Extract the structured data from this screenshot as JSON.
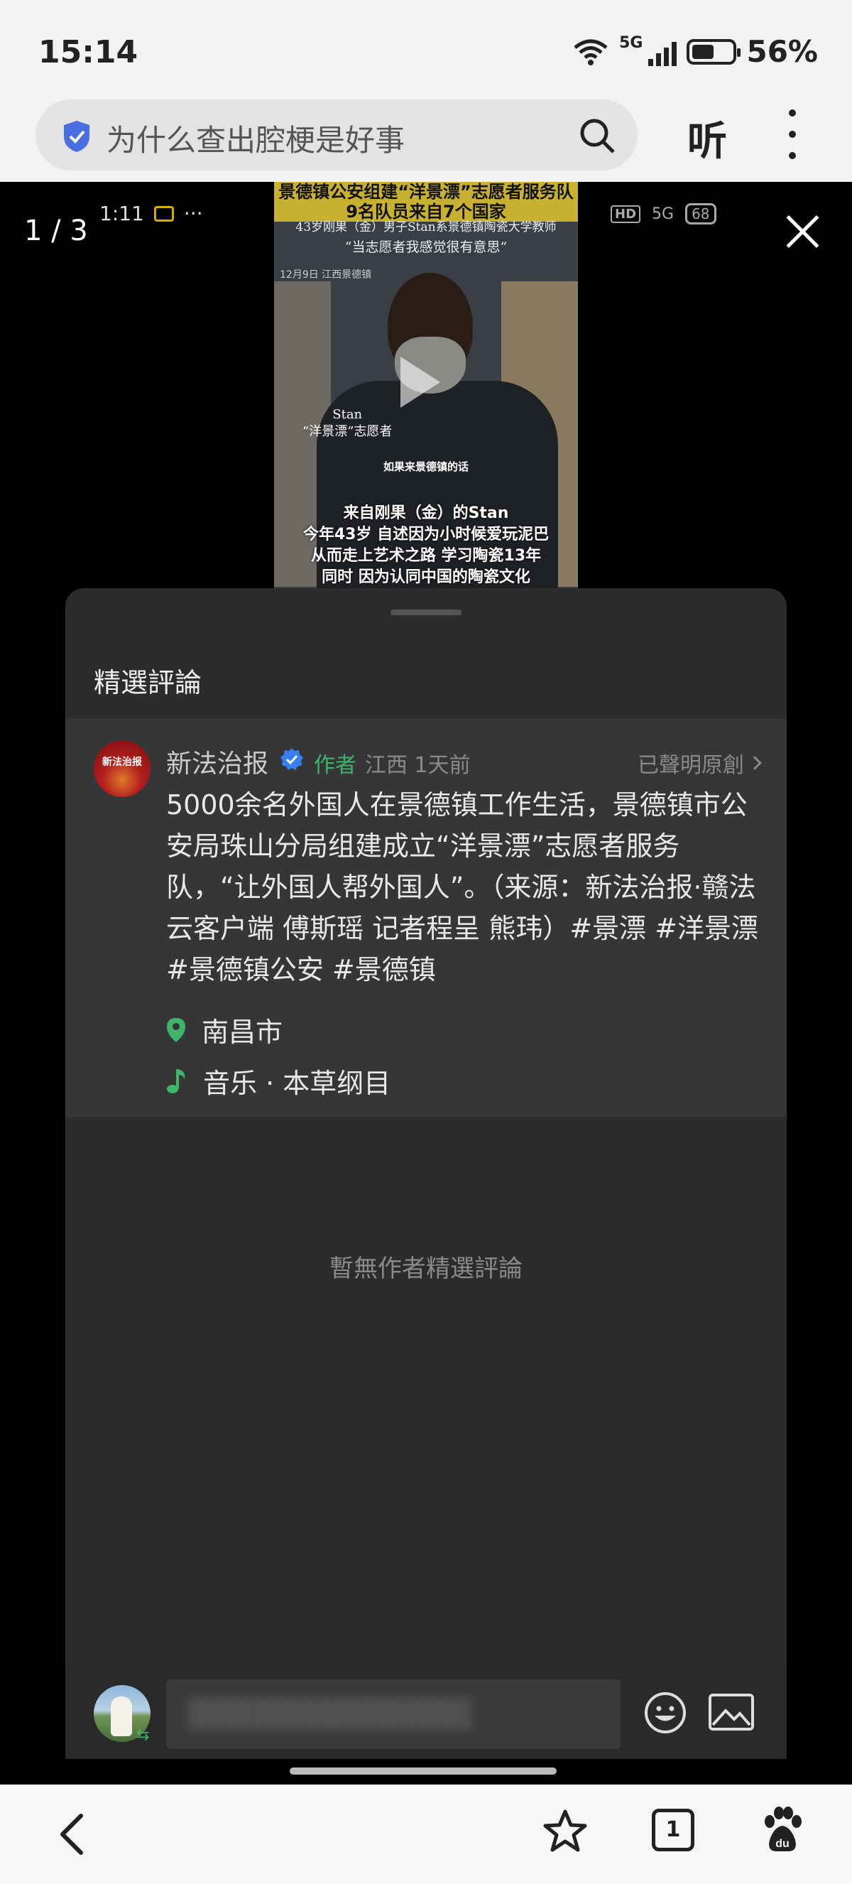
{
  "status_bar": {
    "time": "15:14",
    "network": "5G",
    "battery": "56%"
  },
  "search": {
    "query": "为什么查出腔梗是好事",
    "listen_label": "听"
  },
  "viewer": {
    "page_indicator": "1 / 3"
  },
  "video_thumb": {
    "status_time": "1:11",
    "status_dots": "···",
    "status_hd": "HD",
    "status_network": "5G",
    "status_battery": "68",
    "header_line1": "景德镇公安组建“洋景漂”志愿者服务队",
    "header_line2": "9名队员来自7个国家",
    "sub_line1": "43岁刚果（金）男子Stan系景德镇陶瓷大学教师",
    "sub_line2": "“当志愿者我感觉很有意思”",
    "date_line": "12月9日 江西景德镇",
    "name_tag_line1": "Stan",
    "name_tag_line2": "“洋景漂”志愿者",
    "quote": "如果来景德镇的话",
    "subtitle_line1": "来自刚果（金）的Stan",
    "subtitle_line2": "今年43岁 自述因为小时候爱玩泥巴",
    "subtitle_line3": "从而走上艺术之路 学习陶瓷13年",
    "subtitle_line4": "同时 因为认同中国的陶瓷文化"
  },
  "sheet": {
    "title": "精選評論",
    "comment": {
      "avatar_text": "新法治报",
      "author": "新法治报",
      "author_tag": "作者",
      "meta": "江西 1天前",
      "original_claim": "已聲明原創",
      "body": "5000余名外国人在景德镇工作生活，景德镇市公安局珠山分局组建成立“洋景漂”志愿者服务队，“让外国人帮外国人”。（来源：新法治报·赣法云客户端 傅斯瑶 记者程呈 熊玮）#景漂 #洋景漂 #景德镇公安 #景德镇",
      "location": "南昌市",
      "music": "音乐 · 本草纲目"
    },
    "empty_text": "暫無作者精選評論",
    "input_swap_mark": "⇆"
  },
  "bottom_nav": {
    "tabs_count": "1"
  },
  "colors": {
    "accent_green": "#3eb56a",
    "verified_blue": "#3a7ff2",
    "shield_blue": "#4a6ee0"
  }
}
